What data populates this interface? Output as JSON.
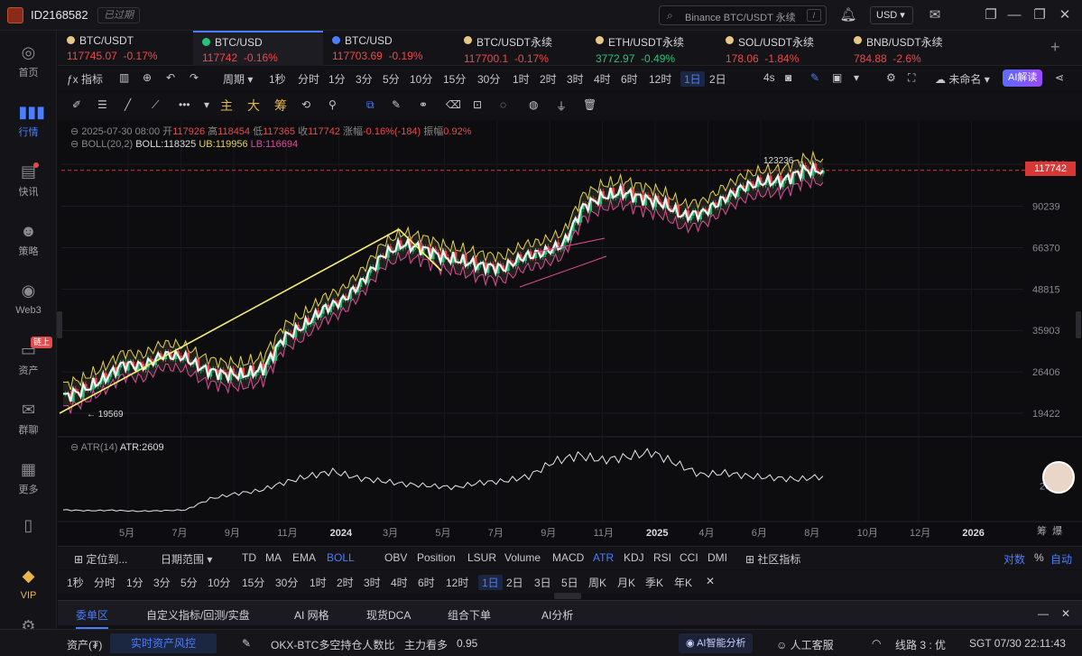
{
  "titlebar": {
    "user_id": "ID2168582",
    "expired_label": "已过期",
    "search_placeholder": "Binance BTC/USDT 永续",
    "search_kbd": "/",
    "currency": "USD"
  },
  "sidebar": {
    "items": [
      {
        "label": "首页",
        "icon": "home-icon"
      },
      {
        "label": "行情",
        "icon": "chart-bars-icon",
        "active": true
      },
      {
        "label": "快讯",
        "icon": "news-icon"
      },
      {
        "label": "策略",
        "icon": "robot-icon"
      },
      {
        "label": "Web3",
        "icon": "web3-icon"
      },
      {
        "label": "资产",
        "icon": "wallet-icon",
        "tag": "链上"
      },
      {
        "label": "群聊",
        "icon": "chat-icon"
      },
      {
        "label": "更多",
        "icon": "grid-icon"
      },
      {
        "label": "",
        "icon": "phone-icon"
      },
      {
        "label": "VIP",
        "icon": "vip-icon"
      },
      {
        "label": "",
        "icon": "settings-icon"
      }
    ]
  },
  "tabs": [
    {
      "name": "BTC/USDT",
      "price": "117745.07",
      "change": "-0.17%"
    },
    {
      "name": "BTC/USD",
      "price": "117742",
      "change": "-0.16%",
      "active": true
    },
    {
      "name": "BTC/USD",
      "price": "117703.69",
      "change": "-0.19%"
    },
    {
      "name": "BTC/USDT永续",
      "price": "117700.1",
      "change": "-0.17%"
    },
    {
      "name": "ETH/USDT永续",
      "price": "3772.97",
      "change": "-0.49%",
      "up": true
    },
    {
      "name": "SOL/USDT永续",
      "price": "178.06",
      "change": "-1.84%"
    },
    {
      "name": "BNB/USDT永续",
      "price": "784.88",
      "change": "-2.6%"
    }
  ],
  "toolbar1": {
    "indicator": "指标",
    "period": "周期",
    "timeframes": [
      "1秒",
      "分时",
      "1分",
      "3分",
      "5分",
      "10分",
      "15分",
      "30分",
      "1时",
      "2时",
      "3时",
      "4时",
      "6时",
      "12时",
      "1日",
      "2日"
    ],
    "selected_tf": "1日",
    "right_tf": "4s",
    "unnamed": "未命名",
    "ai_label": "AI解读"
  },
  "toolbar2": {
    "zhu": "主",
    "da": "大",
    "chou": "筹"
  },
  "chart_info": {
    "date": "2025-07-30 08:00",
    "open_label": "开",
    "open": "117926",
    "high_label": "高",
    "high": "118454",
    "low_label": "低",
    "low": "117365",
    "close_label": "收",
    "close": "117742",
    "chg_label": "涨幅",
    "chg": "-0.16%(-184)",
    "amp_label": "振幅",
    "amp": "0.92%",
    "boll_name": "BOLL(20,2)",
    "boll": "BOLL:118325",
    "ub": "UB:119956",
    "lb": "LB:116694",
    "atr_name": "ATR(14)",
    "atr": "ATR:2609",
    "high_marker": "123236",
    "low_marker": "19569",
    "price_tag": "117742"
  },
  "chart_data": {
    "type": "candlestick",
    "y_scale": "log",
    "y_ticks": [
      "123236",
      "90239",
      "66370",
      "48815",
      "35903",
      "26406",
      "19422"
    ],
    "x_ticks": [
      "5月",
      "7月",
      "9月",
      "11月",
      "2024",
      "3月",
      "5月",
      "7月",
      "9月",
      "11月",
      "2025",
      "4月",
      "6月",
      "8月",
      "10月",
      "12月",
      "2026"
    ],
    "atr_ticks": [
      "2000"
    ],
    "close_series_approx": [
      22000,
      23000,
      25000,
      28000,
      27500,
      30000,
      29500,
      27000,
      26000,
      25800,
      27000,
      34000,
      37000,
      42000,
      45000,
      52000,
      63000,
      68000,
      66000,
      62000,
      60000,
      58000,
      57000,
      62000,
      64000,
      68000,
      90000,
      97000,
      100000,
      96000,
      92000,
      84000,
      86000,
      95000,
      104000,
      108000,
      109000,
      118000,
      117742
    ],
    "current_price": 117742,
    "atr_series_approx": [
      500,
      450,
      480,
      420,
      450,
      500,
      1200,
      1500,
      1700,
      2200,
      2600,
      2900,
      2500,
      2300,
      2100,
      2000,
      1900,
      2200,
      2300,
      2600,
      3500,
      3900,
      3600,
      3800,
      4100,
      3400,
      2700,
      2800,
      2600,
      2500,
      2400,
      2609
    ]
  },
  "indicator_bar": {
    "locate": "定位到...",
    "date_range": "日期范围",
    "main_inds": [
      "TD",
      "MA",
      "EMA",
      "BOLL"
    ],
    "selected_main": "BOLL",
    "sub_inds": [
      "OBV",
      "Position",
      "LSUR",
      "Volume",
      "MACD",
      "ATR",
      "KDJ",
      "RSI",
      "CCI",
      "DMI"
    ],
    "selected_sub": "ATR",
    "community": "社区指标",
    "log": "对数",
    "pct": "%",
    "auto": "自动"
  },
  "tf_bar": {
    "items": [
      "1秒",
      "分时",
      "1分",
      "3分",
      "5分",
      "10分",
      "15分",
      "30分",
      "1时",
      "2时",
      "3时",
      "4时",
      "6时",
      "12时",
      "1日",
      "2日",
      "3日",
      "5日",
      "周K",
      "月K",
      "季K",
      "年K"
    ],
    "selected": "1日"
  },
  "order_tabs": {
    "items": [
      "委单区",
      "自定义指标/回测/实盘",
      "AI 网格",
      "现货DCA",
      "组合下单",
      "AI分析"
    ],
    "active": "委单区"
  },
  "statusbar": {
    "assets": "资产(₮)",
    "risk": "实时资产风控",
    "ticker_text": "OKX-BTC多空持仓人数比",
    "ticker_tag": "主力看多",
    "ticker_val": "0.95",
    "ai_analysis": "AI智能分析",
    "service": "人工客服",
    "line": "线路 3 : 优",
    "time": "SGT 07/30 22:11:43"
  },
  "colors": {
    "accent": "#4a7dff",
    "up": "#26c27a",
    "down": "#f04848",
    "boll_ub": "#e8d44a",
    "boll_lb": "#e04a9a"
  }
}
